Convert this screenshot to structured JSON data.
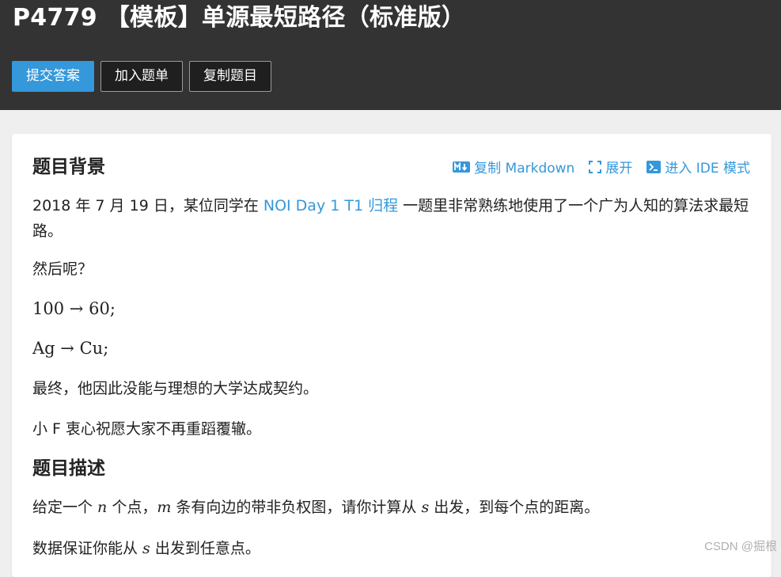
{
  "problem": {
    "title": "P4779 【模板】单源最短路径（标准版）"
  },
  "actions": {
    "submit": "提交答案",
    "add_to_list": "加入题单",
    "copy_problem": "复制题目"
  },
  "toolbar": {
    "copy_markdown": "复制 Markdown",
    "expand": "展开",
    "ide_mode": "进入 IDE 模式"
  },
  "background": {
    "heading": "题目背景",
    "intro_before_link": "2018 年 7 月 19 日，某位同学在 ",
    "intro_link": "NOI Day 1 T1 归程",
    "intro_after_link": " 一题里非常熟练地使用了一个广为人知的算法求最短路。",
    "then": "然后呢？",
    "line1_left": "100",
    "line1_right": "60",
    "line2_left": "Ag",
    "line2_right": "Cu",
    "arrow": "→",
    "semicolon": ";",
    "finally": "最终，他因此没能与理想的大学达成契约。",
    "wish": "小 F 衷心祝愿大家不再重蹈覆辙。"
  },
  "description": {
    "heading": "题目描述",
    "p1_part1": "给定一个 ",
    "p1_var_n": "n",
    "p1_part2": " 个点，",
    "p1_var_m": "m",
    "p1_part3": " 条有向边的带非负权图，请你计算从 ",
    "p1_var_s": "s",
    "p1_part4": " 出发，到每个点的距离。",
    "p2_part1": "数据保证你能从 ",
    "p2_var_s": "s",
    "p2_part2": " 出发到任意点。"
  },
  "watermark": "CSDN @掘根",
  "colors": {
    "header_bg": "#333333",
    "accent": "#3498db",
    "page_bg": "#efefef"
  },
  "icons": {
    "markdown": "markdown-icon",
    "expand": "expand-icon",
    "ide": "terminal-icon"
  }
}
